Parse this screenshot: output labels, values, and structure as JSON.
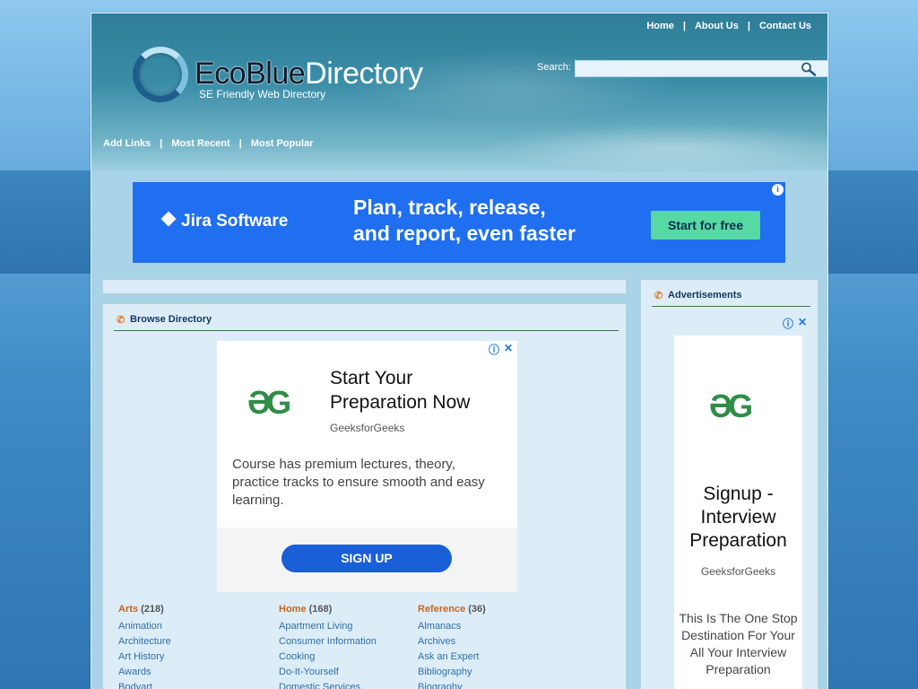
{
  "nav": {
    "home": "Home",
    "about": "About Us",
    "contact": "Contact Us",
    "separator": "|"
  },
  "logo": {
    "eco": "EcoBlue",
    "directory": "Directory",
    "subtitle": "SE Friendly Web Directory"
  },
  "search": {
    "label": "Search:",
    "value": ""
  },
  "subnav": {
    "add_links": "Add Links",
    "most_recent": "Most Recent",
    "most_popular": "Most Popular",
    "separator": "|"
  },
  "banner_ad": {
    "brand": "Jira Software",
    "headline_line1": "Plan, track, release,",
    "headline_line2": "and report, even faster",
    "cta": "Start for free",
    "info": "i"
  },
  "browse": {
    "title": "Browse Directory",
    "ad": {
      "logo": "ƏG",
      "title": "Start Your Preparation Now",
      "source": "GeeksforGeeks",
      "description": "Course has premium lectures, theory, practice tracks to ensure smooth and easy learning.",
      "button": "SIGN UP",
      "info": "ⓘ",
      "close": "✕"
    },
    "categories": [
      {
        "name": "Arts",
        "count": "(218)",
        "subs": [
          "Animation",
          "Architecture",
          "Art History",
          "Awards",
          "Bodyart"
        ]
      },
      {
        "name": "Home",
        "count": "(168)",
        "subs": [
          "Apartment Living",
          "Consumer Information",
          "Cooking",
          "Do-It-Yourself",
          "Domestic Services"
        ]
      },
      {
        "name": "Reference",
        "count": "(36)",
        "subs": [
          "Almanacs",
          "Archives",
          "Ask an Expert",
          "Bibliography",
          "Biography"
        ]
      }
    ]
  },
  "sidebar": {
    "title": "Advertisements",
    "ad": {
      "logo": "ƏG",
      "title": "Signup - Interview Preparation",
      "source": "GeeksforGeeks",
      "description": "This Is The One Stop Destination For Your All Your Interview Preparation",
      "info": "ⓘ",
      "close": "✕"
    }
  },
  "colors": {
    "banner_bg": "#1f6ff0",
    "cta_bg": "#57d9a3",
    "category_head": "#c8651b",
    "link": "#2f6fa6",
    "gfg_green": "#2f8d46"
  }
}
